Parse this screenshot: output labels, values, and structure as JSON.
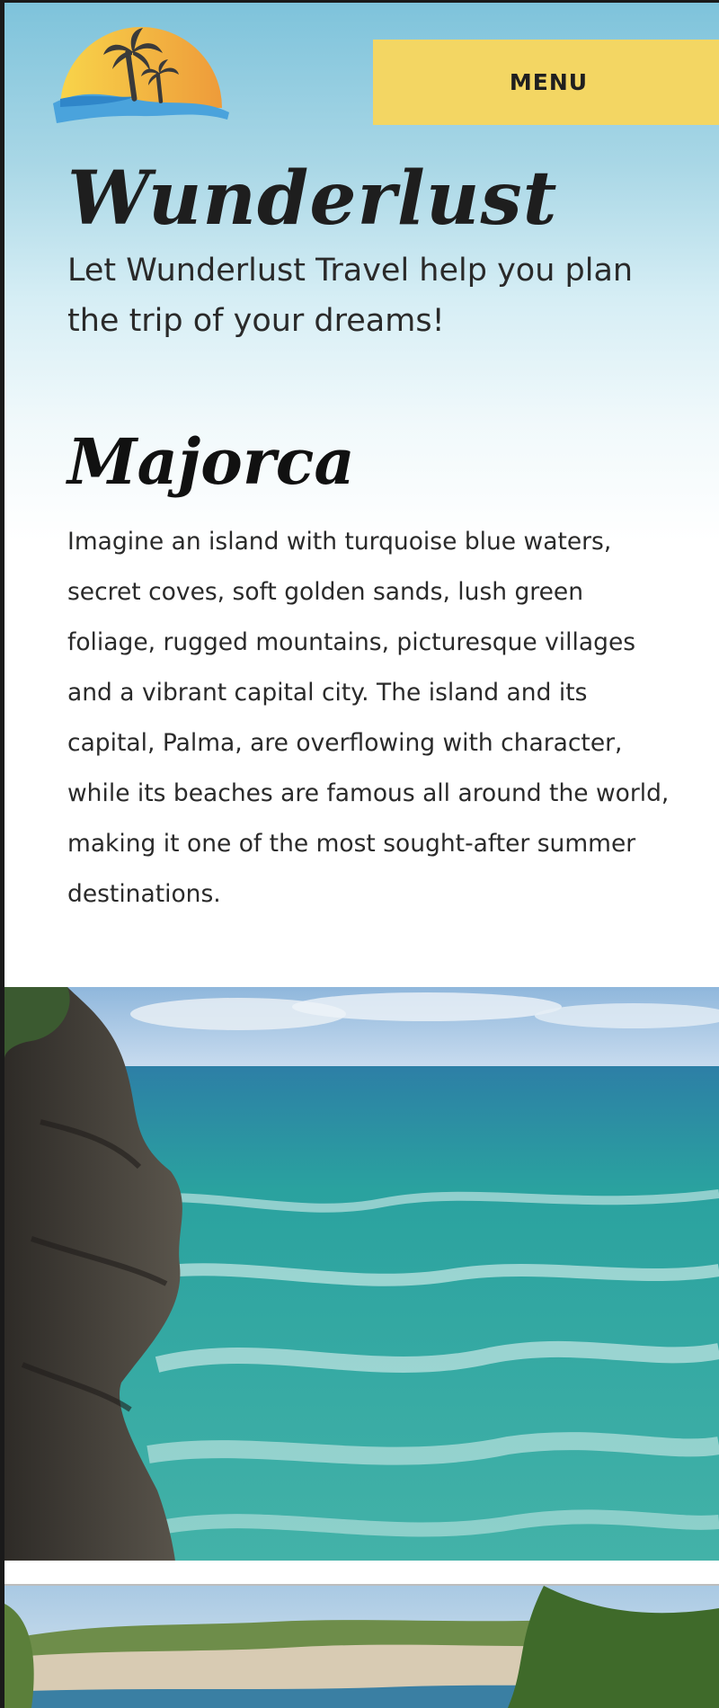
{
  "header": {
    "logo_icon": "palm-island-sun-logo",
    "menu_label": "MENU"
  },
  "hero": {
    "title": "Wunderlust",
    "tagline": "Let Wunderlust Travel help you plan the trip of your dreams!"
  },
  "destination": {
    "title": "Majorca",
    "description": "Imagine an island with turquoise blue waters, secret coves, soft golden sands, lush green foliage, rugged mountains, picturesque villages and a vibrant capital city. The island and its capital, Palma, are overflowing with character, while its beaches are famous all around the world, making it one of the most sought-after summer destinations."
  },
  "images": [
    {
      "icon": "rocky-coast-turquoise-sea-photo"
    },
    {
      "icon": "limestone-cliffs-bay-photo"
    }
  ],
  "colors": {
    "menu_background": "#f3d663",
    "sky_top": "#7ec3db",
    "logo_sun": "#f0b040",
    "logo_wave": "#4aa3dc"
  }
}
